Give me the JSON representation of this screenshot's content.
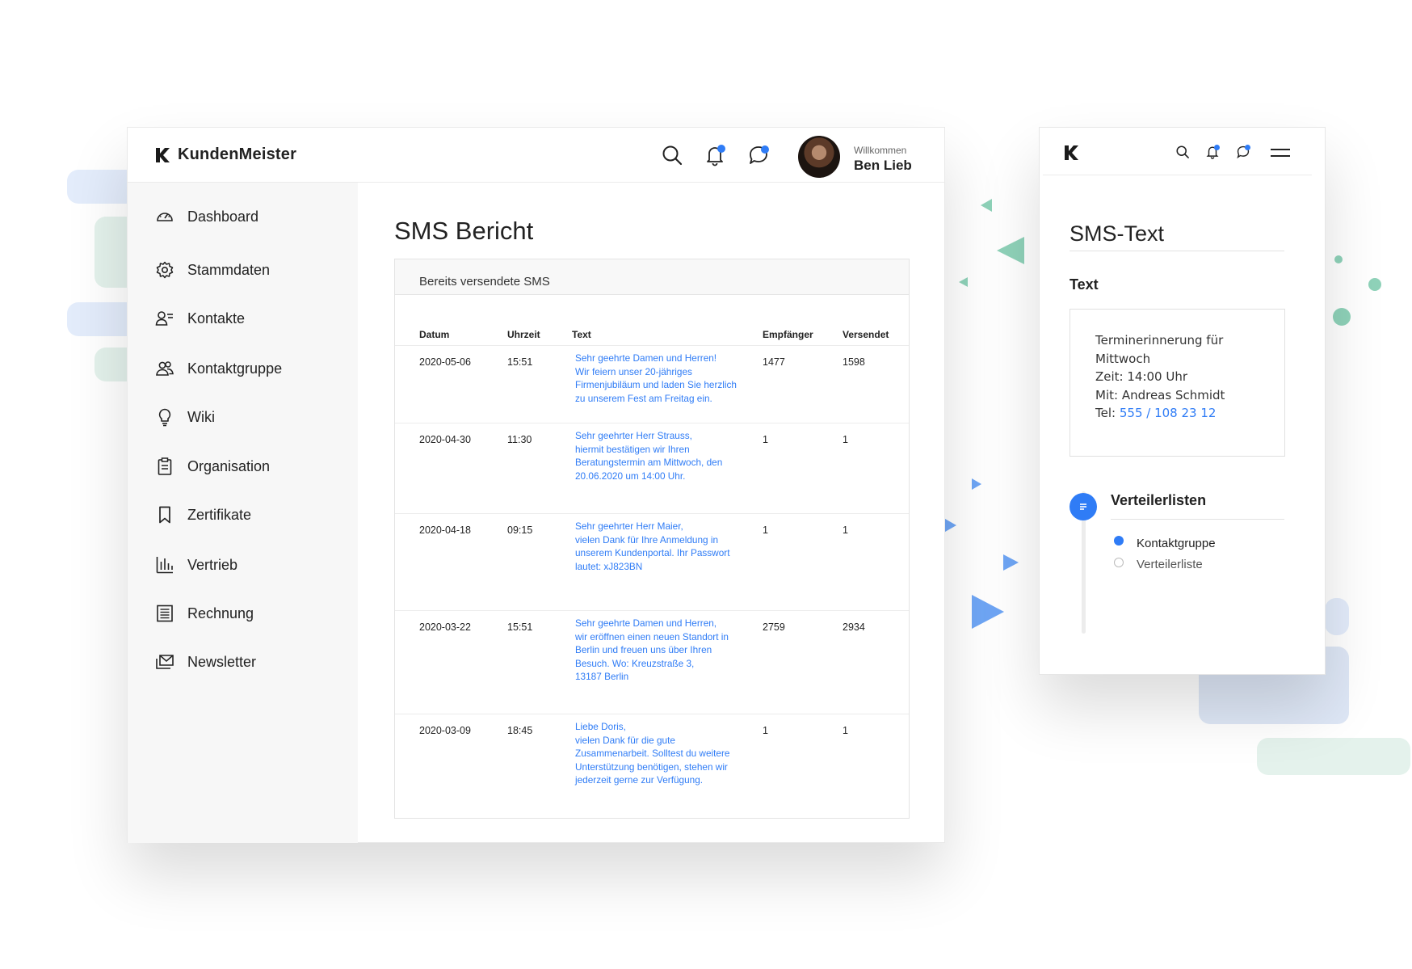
{
  "brand": {
    "name": "KundenMeister",
    "accent": "#2f7cf6"
  },
  "header": {
    "icons": [
      "search-icon",
      "bell-icon",
      "chat-icon"
    ],
    "welcome": "Willkommen",
    "user_name": "Ben Lieb"
  },
  "sidebar": {
    "items": [
      {
        "label": "Dashboard",
        "icon": "gauge-icon"
      },
      {
        "label": "Stammdaten",
        "icon": "gear-icon"
      },
      {
        "label": "Kontakte",
        "icon": "contact-icon"
      },
      {
        "label": "Kontaktgruppe",
        "icon": "group-icon"
      },
      {
        "label": "Wiki",
        "icon": "lightbulb-icon"
      },
      {
        "label": "Organisation",
        "icon": "clipboard-icon"
      },
      {
        "label": "Zertifikate",
        "icon": "bookmark-icon"
      },
      {
        "label": "Vertrieb",
        "icon": "bar-chart-icon"
      },
      {
        "label": "Rechnung",
        "icon": "invoice-icon"
      },
      {
        "label": "Newsletter",
        "icon": "mail-icon"
      }
    ]
  },
  "main": {
    "title": "SMS Bericht",
    "card_title": "Bereits versendete SMS",
    "columns": [
      "Datum",
      "Uhrzeit",
      "Text",
      "Empfänger",
      "Versendet"
    ],
    "rows": [
      {
        "date": "2020-05-06",
        "time": "15:51",
        "text": "Sehr geehrte Damen und Herren!\nWir feiern unser 20-jähriges\nFirmenjubiläum und laden Sie herzlich\nzu unserem Fest am Freitag ein.",
        "recipients": "1477",
        "sent": "1598"
      },
      {
        "date": "2020-04-30",
        "time": "11:30",
        "text": "Sehr geehrter Herr Strauss,\nhiermit bestätigen wir Ihren\nBeratungstermin am Mittwoch, den\n20.06.2020 um 14:00 Uhr.",
        "recipients": "1",
        "sent": "1"
      },
      {
        "date": "2020-04-18",
        "time": "09:15",
        "text": "Sehr geehrter Herr Maier,\nvielen Dank für Ihre Anmeldung in\nunserem Kundenportal. Ihr Passwort\nlautet: xJ823BN",
        "recipients": "1",
        "sent": "1"
      },
      {
        "date": "2020-03-22",
        "time": "15:51",
        "text": "Sehr geehrte Damen und Herren,\nwir eröffnen einen neuen Standort in\nBerlin und freuen uns über Ihren\nBesuch. Wo: Kreuzstraße 3,\n13187 Berlin",
        "recipients": "2759",
        "sent": "2934"
      },
      {
        "date": "2020-03-09",
        "time": "18:45",
        "text": "Liebe Doris,\nvielen Dank für die gute\nZusammenarbeit. Solltest du weitere\nUnterstützung benötigen, stehen wir\njederzeit gerne zur Verfügung.",
        "recipients": "1",
        "sent": "1"
      }
    ]
  },
  "mobile": {
    "title": "SMS-Text",
    "text_heading": "Text",
    "message_lines": [
      "Terminerinnerung für",
      "Mittwoch",
      "Zeit: 14:00 Uhr",
      "Mit: Andreas Schmidt"
    ],
    "tel_label": "Tel:",
    "tel_number": "555 / 108 23 12",
    "lists_heading": "Verteilerlisten",
    "options": [
      {
        "label": "Kontaktgruppe",
        "selected": true
      },
      {
        "label": "Verteilerliste",
        "selected": false
      }
    ]
  }
}
